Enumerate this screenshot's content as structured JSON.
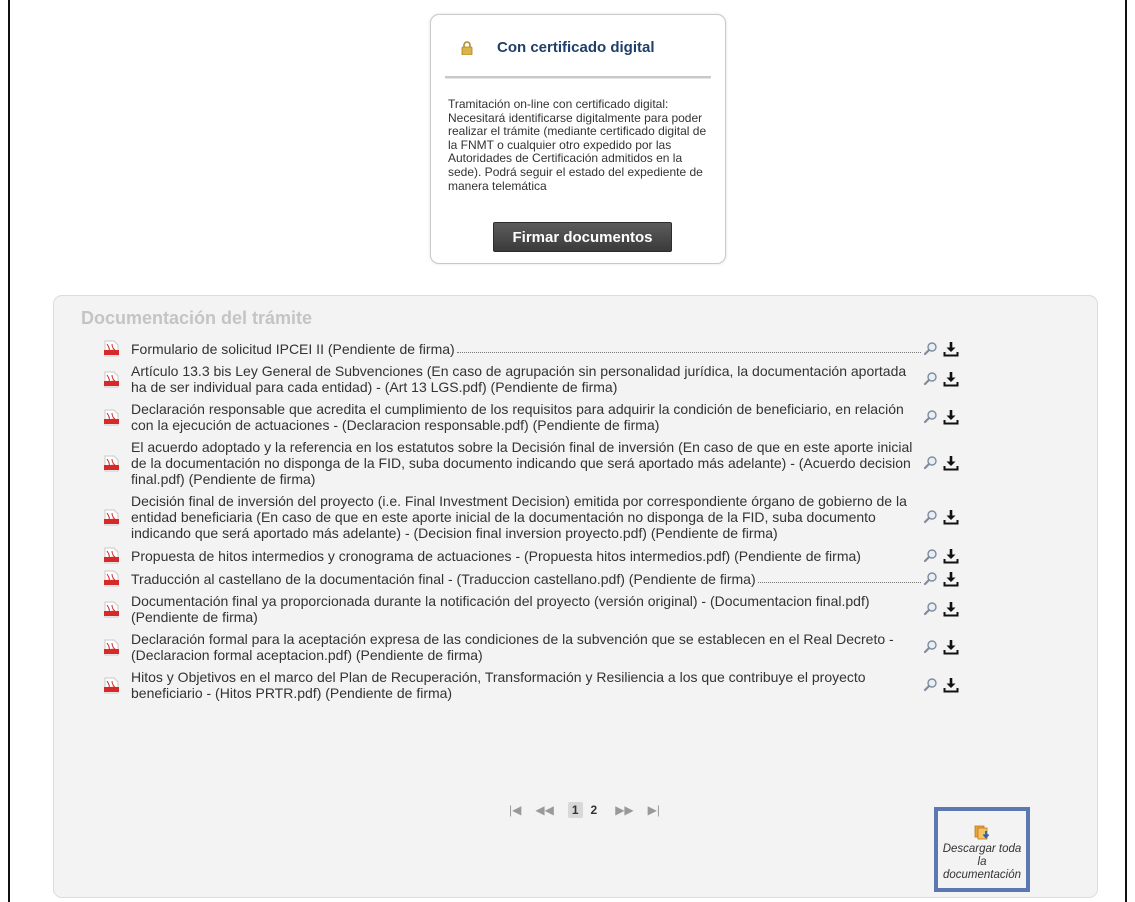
{
  "certificate": {
    "icon": "lock-icon",
    "title": "Con certificado digital",
    "description": "Tramitación on-line con certificado digital: Necesitará identificarse digitalmente para poder realizar el trámite (mediante certificado digital de la FNMT o cualquier otro expedido por las Autoridades de Certificación admitidos en la sede). Podrá seguir el estado del expediente de manera telemática",
    "button_label": "Firmar documentos"
  },
  "documents": {
    "title": "Documentación del trámite",
    "items": [
      {
        "text": "Formulario de solicitud IPCEI II (Pendiente de firma)"
      },
      {
        "text": "Artículo 13.3 bis Ley General de Subvenciones (En caso de agrupación sin personalidad jurídica, la documentación aportada ha de ser individual para cada entidad) - (Art 13 LGS.pdf) (Pendiente de firma)"
      },
      {
        "text": "Declaración responsable que acredita el cumplimiento de los requisitos para adquirir la condición de beneficiario, en relación con la ejecución de actuaciones - (Declaracion responsable.pdf) (Pendiente de firma)"
      },
      {
        "text": "El acuerdo adoptado y la referencia en los estatutos sobre la Decisión final de inversión (En caso de que en este aporte inicial de la documentación no disponga de la FID, suba documento indicando que será aportado más adelante) - (Acuerdo decision final.pdf) (Pendiente de firma)"
      },
      {
        "text": "Decisión final de inversión del proyecto (i.e. Final Investment Decision) emitida por correspondiente órgano de gobierno de la entidad beneficiaria (En caso de que en este aporte inicial de la documentación no disponga de la FID, suba documento indicando que será aportado más adelante) - (Decision final inversion proyecto.pdf) (Pendiente de firma)"
      },
      {
        "text": "Propuesta de hitos intermedios y cronograma de actuaciones - (Propuesta hitos intermedios.pdf) (Pendiente de firma)"
      },
      {
        "text": "Traducción al castellano de la documentación final - (Traduccion castellano.pdf) (Pendiente de firma)"
      },
      {
        "text": "Documentación final ya proporcionada durante la notificación del proyecto (versión original) - (Documentacion final.pdf) (Pendiente de firma)"
      },
      {
        "text": "Declaración formal para la aceptación expresa de las condiciones de la subvención que se establecen en el Real Decreto - (Declaracion formal aceptacion.pdf) (Pendiente de firma)"
      },
      {
        "text": "Hitos y Objetivos en el marco del Plan de Recuperación, Transformación y Resiliencia a los que contribuye el proyecto beneficiario - (Hitos PRTR.pdf) (Pendiente de firma)"
      }
    ]
  },
  "pager": {
    "first": "|◀",
    "prev": "◀◀",
    "pages": [
      "1",
      "2"
    ],
    "active_page": "1",
    "next": "▶▶",
    "last": "▶|"
  },
  "download_all": {
    "label": "Descargar toda la documentación",
    "icon": "download-all-icon"
  },
  "colors": {
    "cert_title": "#1f3f68",
    "panel_bg": "#f3f3f3",
    "highlight_border": "#5b78b0",
    "pdf_red": "#d62a2a"
  }
}
